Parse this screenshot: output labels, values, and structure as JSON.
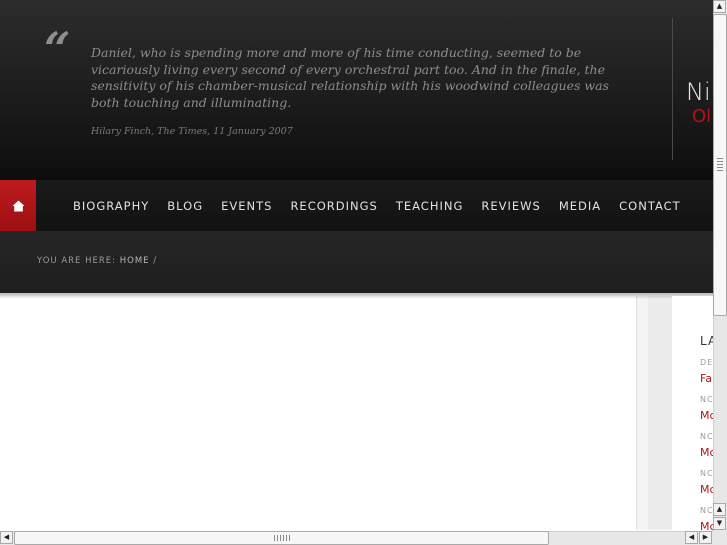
{
  "header": {
    "quote_mark": "“",
    "quote": "Daniel, who is spending more and more of his time conducting, seemed to be vicariously living every second of every orchestral part too. And in the finale, the sensitivity of his chamber-musical relationship with his woodwind colleagues was both touching and illuminating.",
    "citation": "Hilary Finch, The Times, 11 January 2007",
    "brand_line1": "Ni",
    "brand_line2": "Ol"
  },
  "nav": {
    "home_icon": "home-icon",
    "items": [
      "BIOGRAPHY",
      "BLOG",
      "EVENTS",
      "RECORDINGS",
      "TEACHING",
      "REVIEWS",
      "MEDIA",
      "CONTACT"
    ]
  },
  "breadcrumb": {
    "prefix": "YOU ARE HERE:",
    "home": "HOME",
    "separator": "/"
  },
  "sidebar": {
    "title": "LA",
    "entries": [
      {
        "date": "DE",
        "link": "Fa"
      },
      {
        "date": "NC",
        "link": "Mc"
      },
      {
        "date": "NC",
        "link": "Mc"
      },
      {
        "date": "NC",
        "link": "Mc"
      },
      {
        "date": "NC",
        "link": "Mc"
      }
    ]
  },
  "scrollbar_icons": {
    "up": "▲",
    "down": "▼",
    "left": "◀",
    "right": "▶"
  },
  "colors": {
    "accent_red": "#b01217",
    "header_bg": "#1c1c1c"
  }
}
